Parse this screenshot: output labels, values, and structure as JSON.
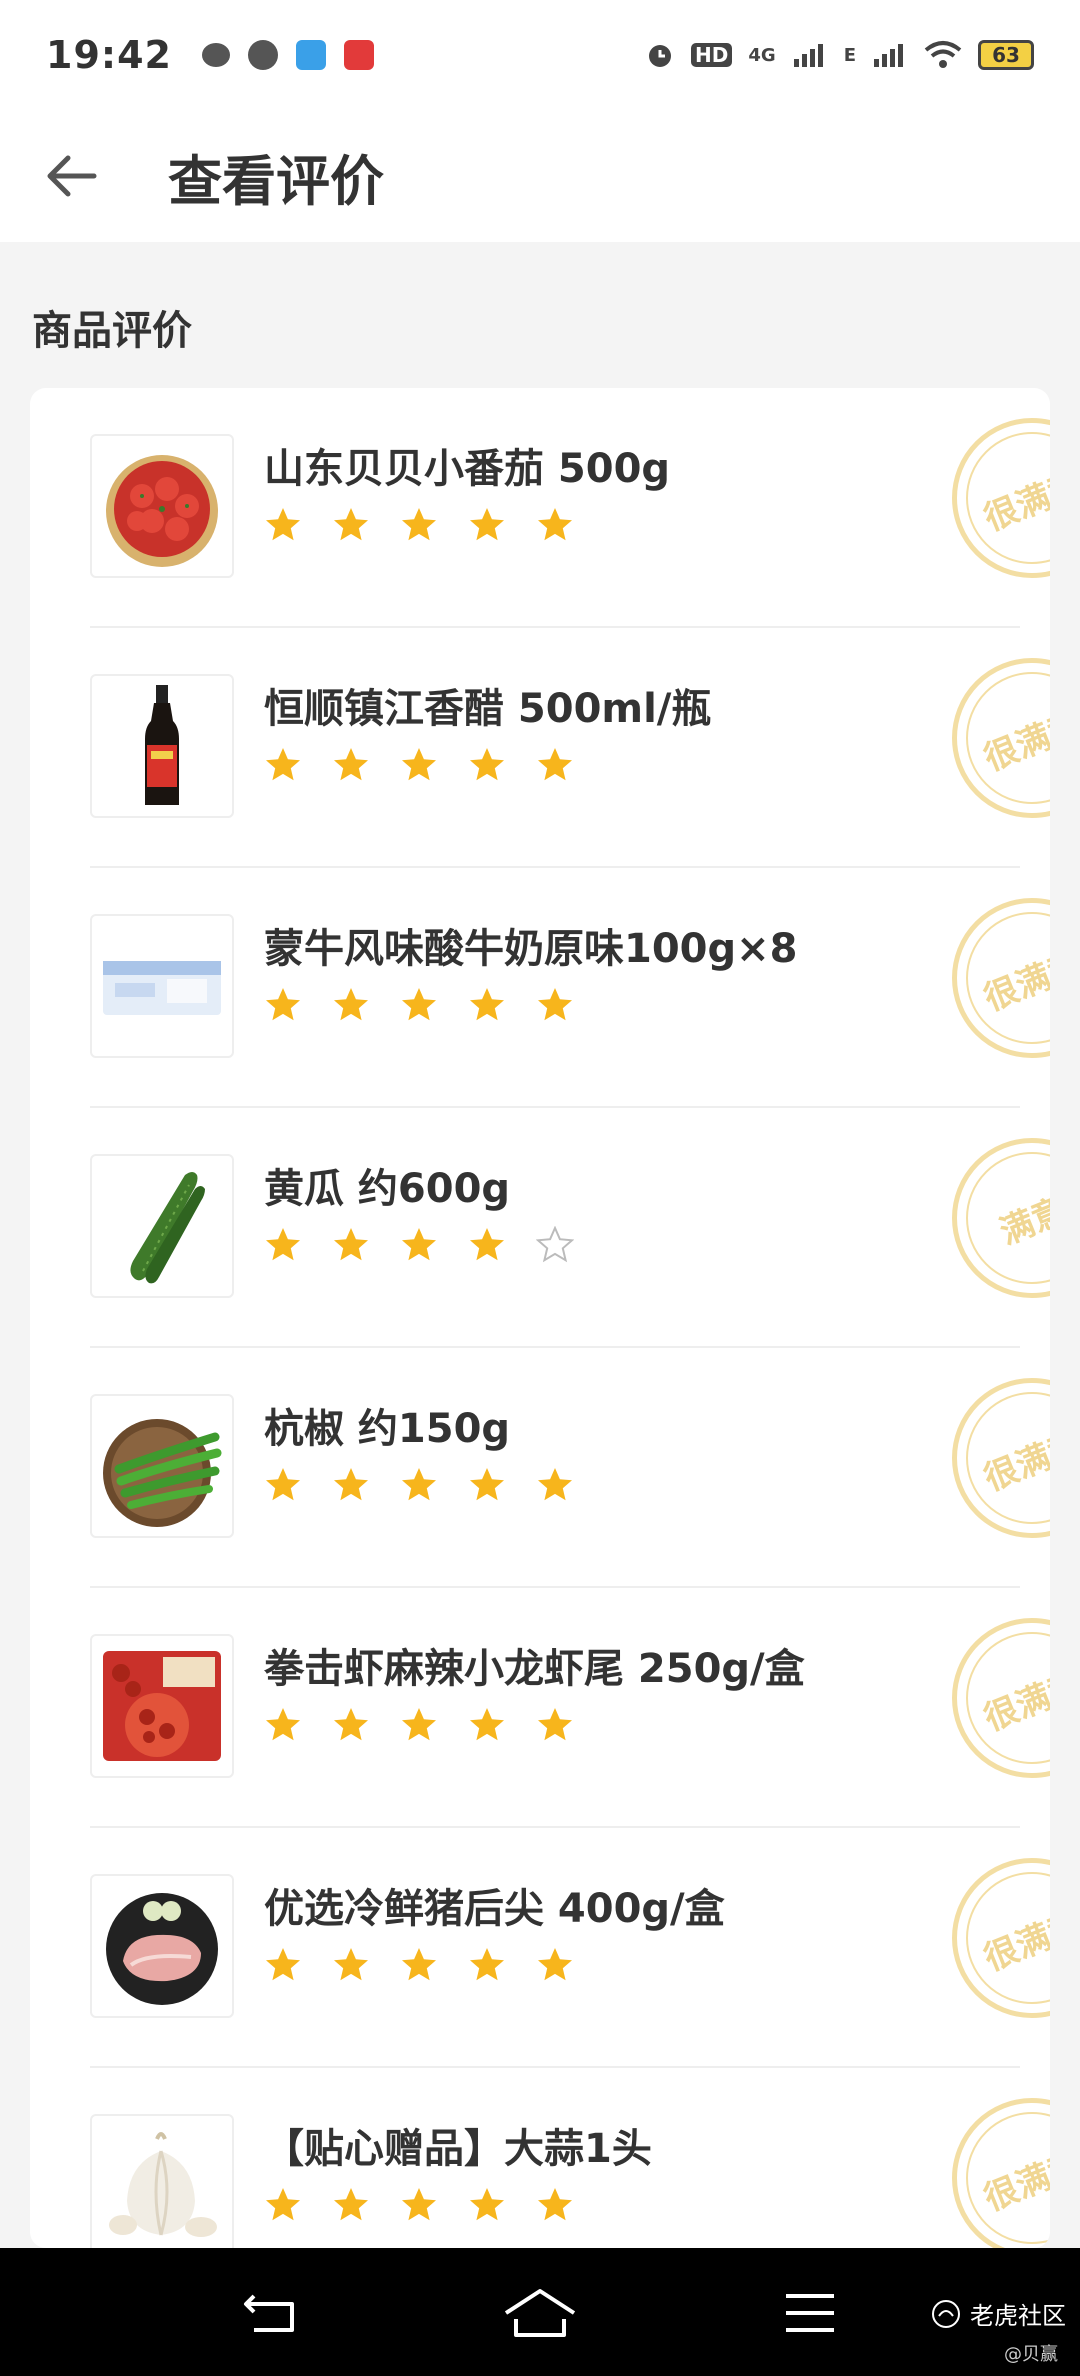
{
  "status": {
    "time": "19:42",
    "battery": "63",
    "network": "4G",
    "network2": "E"
  },
  "header": {
    "title": "查看评价"
  },
  "section": {
    "title": "商品评价"
  },
  "items": [
    {
      "name": "山东贝贝小番茄 500g",
      "rating": 5,
      "stamp": "很满意"
    },
    {
      "name": "恒顺镇江香醋 500ml/瓶",
      "rating": 5,
      "stamp": "很满意"
    },
    {
      "name": "蒙牛风味酸牛奶原味100g×8",
      "rating": 5,
      "stamp": "很满意"
    },
    {
      "name": "黄瓜 约600g",
      "rating": 4,
      "stamp": "满意"
    },
    {
      "name": "杭椒 约150g",
      "rating": 5,
      "stamp": "很满意"
    },
    {
      "name": "拳击虾麻辣小龙虾尾 250g/盒",
      "rating": 5,
      "stamp": "很满意"
    },
    {
      "name": "优选冷鲜猪后尖 400g/盒",
      "rating": 5,
      "stamp": "很满意"
    },
    {
      "name": "【贴心赠品】大蒜1头",
      "rating": 5,
      "stamp": "很满意"
    }
  ],
  "watermark": {
    "brand": "老虎社区",
    "user": "@贝赢"
  },
  "colors": {
    "star_filled": "#f7b51c",
    "star_empty": "#bbbbbb",
    "stamp": "#f3dea3"
  }
}
